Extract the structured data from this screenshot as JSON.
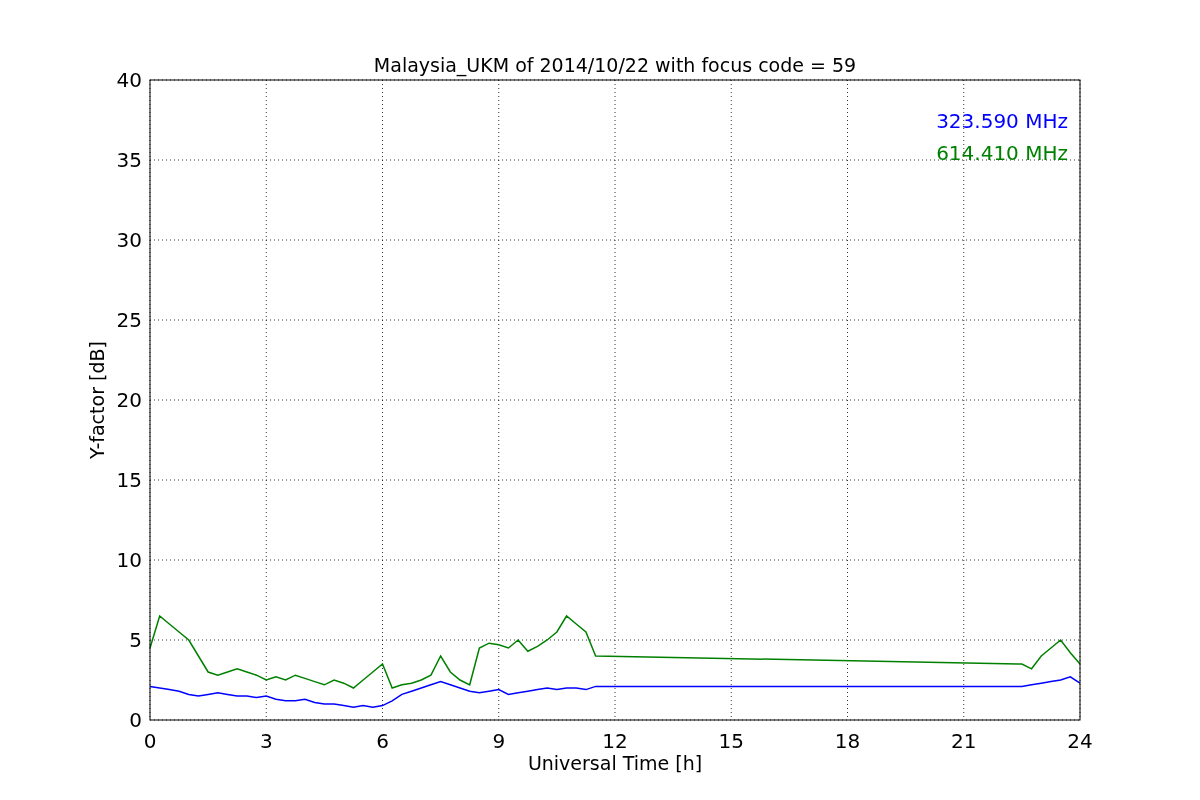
{
  "figure": {
    "chart_data": {
      "type": "line",
      "title": "Malaysia_UKM of 2014/10/22 with focus code = 59",
      "xlabel": "Universal Time [h]",
      "ylabel": "Y-factor [dB]",
      "x": [
        0,
        0.25,
        0.5,
        0.75,
        1,
        1.25,
        1.5,
        1.75,
        2,
        2.25,
        2.5,
        2.75,
        3,
        3.25,
        3.5,
        3.75,
        4,
        4.25,
        4.5,
        4.75,
        5,
        5.25,
        5.5,
        5.75,
        6,
        6.25,
        6.5,
        6.75,
        7,
        7.25,
        7.5,
        7.75,
        8,
        8.25,
        8.5,
        8.75,
        9,
        9.25,
        9.5,
        9.75,
        10,
        10.25,
        10.5,
        10.75,
        11,
        11.25,
        11.5,
        22.5,
        22.75,
        23,
        23.25,
        23.5,
        23.75,
        24
      ],
      "series": [
        {
          "name": "323.590 MHz",
          "color": "#0000ff",
          "values": [
            2.1,
            2.0,
            1.9,
            1.8,
            1.6,
            1.5,
            1.6,
            1.7,
            1.6,
            1.5,
            1.5,
            1.4,
            1.5,
            1.3,
            1.2,
            1.2,
            1.3,
            1.1,
            1.0,
            1.0,
            0.9,
            0.8,
            0.9,
            0.8,
            0.9,
            1.2,
            1.6,
            1.8,
            2.0,
            2.2,
            2.4,
            2.2,
            2.0,
            1.8,
            1.7,
            1.8,
            1.9,
            1.6,
            1.7,
            1.8,
            1.9,
            2.0,
            1.9,
            2.0,
            2.0,
            1.9,
            2.1,
            2.1,
            2.2,
            2.3,
            2.4,
            2.5,
            2.7,
            2.3
          ]
        },
        {
          "name": "614.410 MHz",
          "color": "#008000",
          "values": [
            4.5,
            6.5,
            6.0,
            5.5,
            5.0,
            4.0,
            3.0,
            2.8,
            3.0,
            3.2,
            3.0,
            2.8,
            2.5,
            2.7,
            2.5,
            2.8,
            2.6,
            2.4,
            2.2,
            2.5,
            2.3,
            2.0,
            2.5,
            3.0,
            3.5,
            2.0,
            2.2,
            2.3,
            2.5,
            2.8,
            4.0,
            3.0,
            2.5,
            2.2,
            4.5,
            4.8,
            4.7,
            4.5,
            5.0,
            4.3,
            4.6,
            5.0,
            5.5,
            6.5,
            6.0,
            5.5,
            4.0,
            3.5,
            3.2,
            4.0,
            4.5,
            5.0,
            4.2,
            3.5
          ]
        }
      ],
      "grid": true,
      "xlim": [
        0,
        24
      ],
      "ylim": [
        0,
        40
      ],
      "xticks": [
        0,
        3,
        6,
        9,
        12,
        15,
        18,
        21,
        24
      ],
      "yticks": [
        0,
        5,
        10,
        15,
        20,
        25,
        30,
        35,
        40
      ]
    }
  }
}
